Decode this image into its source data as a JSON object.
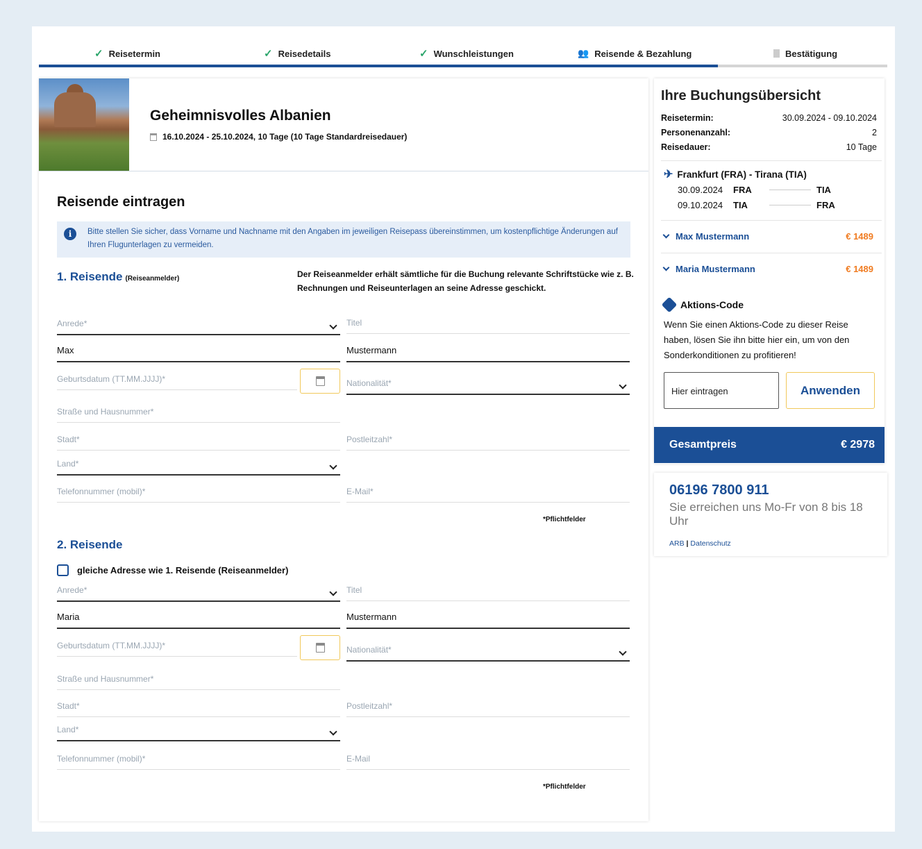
{
  "steps": [
    {
      "label": "Reisetermin",
      "state": "done"
    },
    {
      "label": "Reisedetails",
      "state": "done"
    },
    {
      "label": "Wunschleistungen",
      "state": "done"
    },
    {
      "label": "Reisende & Bezahlung",
      "state": "active"
    },
    {
      "label": "Bestätigung",
      "state": "pending"
    }
  ],
  "trip": {
    "title": "Geheimnisvolles Albanien",
    "dates": "16.10.2024 - 25.10.2024, 10 Tage (10 Tage Standardreisedauer)"
  },
  "form": {
    "section_title": "Reisende eintragen",
    "info_text": "Bitte stellen Sie sicher, dass Vorname und Nachname mit den Angaben im jeweiligen Reisepass übereinstimmen, um kostenpflichtige Änderungen auf Ihren Flugunterlagen zu vermeiden.",
    "traveler1": {
      "heading": "1. Reisende",
      "heading_sub": "(Reiseanmelder)",
      "note": "Der Reiseanmelder erhält sämtliche für die Buchung relevante Schriftstücke wie z. B. Rechnungen und Reiseunterlagen an seine Adresse geschickt.",
      "salutation_placeholder": "Anrede*",
      "title_placeholder": "Titel",
      "first_name": "Max",
      "last_name": "Mustermann",
      "birthdate_placeholder": "Geburtsdatum (TT.MM.JJJJ)*",
      "nationality_placeholder": "Nationalität*",
      "street_placeholder": "Straße und Hausnummer*",
      "city_placeholder": "Stadt*",
      "zip_placeholder": "Postleitzahl*",
      "country_placeholder": "Land*",
      "phone_placeholder": "Telefonnummer (mobil)*",
      "email_placeholder": "E-Mail*",
      "required_note": "*Pflichtfelder"
    },
    "traveler2": {
      "heading": "2. Reisende",
      "same_address_label": "gleiche Adresse wie 1. Reisende (Reiseanmelder)",
      "salutation_placeholder": "Anrede*",
      "title_placeholder": "Titel",
      "first_name": "Maria",
      "last_name": "Mustermann",
      "birthdate_placeholder": "Geburtsdatum (TT.MM.JJJJ)*",
      "nationality_placeholder": "Nationalität*",
      "street_placeholder": "Straße und Hausnummer*",
      "city_placeholder": "Stadt*",
      "zip_placeholder": "Postleitzahl*",
      "country_placeholder": "Land*",
      "phone_placeholder": "Telefonnummer (mobil)*",
      "email_placeholder": "E-Mail",
      "required_note": "*Pflichtfelder"
    }
  },
  "summary": {
    "title": "Ihre Buchungsübersicht",
    "rows": [
      {
        "label": "Reisetermin:",
        "value": "30.09.2024 - 09.10.2024"
      },
      {
        "label": "Personenanzahl:",
        "value": "2"
      },
      {
        "label": "Reisedauer:",
        "value": "10 Tage"
      }
    ],
    "flight_title": "Frankfurt (FRA) - Tirana (TIA)",
    "flights": [
      {
        "date": "30.09.2024",
        "from": "FRA",
        "to": "TIA"
      },
      {
        "date": "09.10.2024",
        "from": "TIA",
        "to": "FRA"
      }
    ],
    "passengers": [
      {
        "name": "Max Mustermann",
        "price": "€ 1489"
      },
      {
        "name": "Maria Mustermann",
        "price": "€ 1489"
      }
    ],
    "promo_title": "Aktions-Code",
    "promo_text": "Wenn Sie einen Aktions-Code zu dieser Reise haben, lösen Sie ihn bitte hier ein, um von den Sonderkonditionen zu profitieren!",
    "promo_placeholder": "Hier eintragen",
    "promo_button": "Anwenden",
    "total_label": "Gesamtpreis",
    "total_value": "€ 2978"
  },
  "contact": {
    "phone": "06196 7800 911",
    "hours": "Sie erreichen uns Mo-Fr von 8 bis 18 Uhr",
    "link_arb": "ARB",
    "separator": "|",
    "link_privacy": "Datenschutz"
  },
  "colors": {
    "primary": "#1b4f96",
    "accent_price": "#f07c22",
    "check": "#2aa56a",
    "button_border": "#f1c85a",
    "background": "#e4edf4"
  }
}
